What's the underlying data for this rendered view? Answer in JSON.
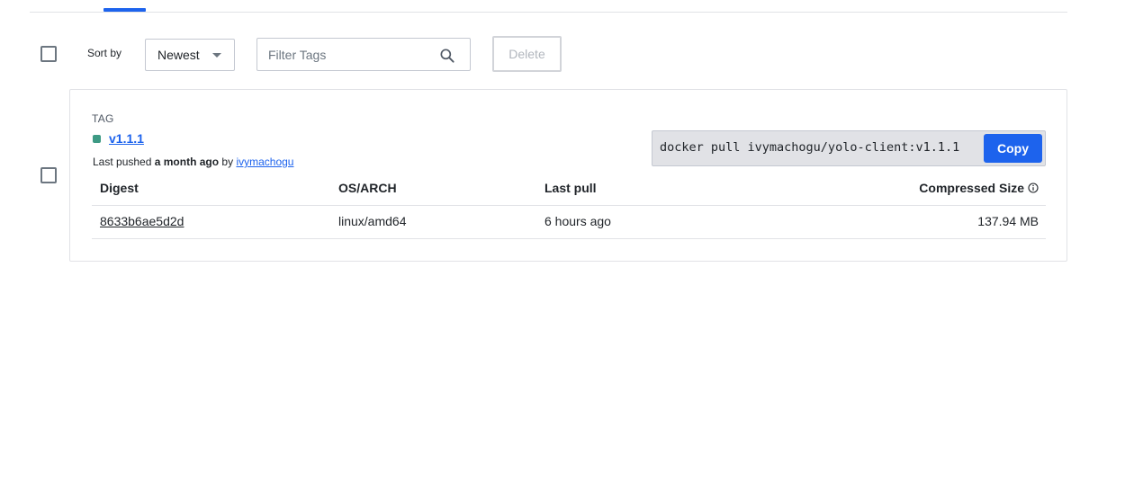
{
  "toolbar": {
    "sort_label": "Sort by",
    "sort_value": "Newest",
    "filter_placeholder": "Filter Tags",
    "delete_label": "Delete"
  },
  "tag": {
    "heading": "TAG",
    "name": "v1.1.1",
    "status_color": "#3d9a84",
    "pushed_prefix": "Last pushed",
    "pushed_when": "a month ago",
    "pushed_by_word": "by",
    "pushed_by_user": "ivymachogu",
    "pull_command": "docker pull ivymachogu/yolo-client:v1.1.1",
    "copy_label": "Copy"
  },
  "table": {
    "headers": [
      "Digest",
      "OS/ARCH",
      "Last pull",
      "Compressed Size"
    ],
    "rows": [
      {
        "digest": "8633b6ae5d2d",
        "os_arch": "linux/amd64",
        "last_pull": "6 hours ago",
        "size": "137.94 MB"
      }
    ]
  },
  "colors": {
    "accent": "#1d63ed",
    "border": "#e1e2e6"
  }
}
